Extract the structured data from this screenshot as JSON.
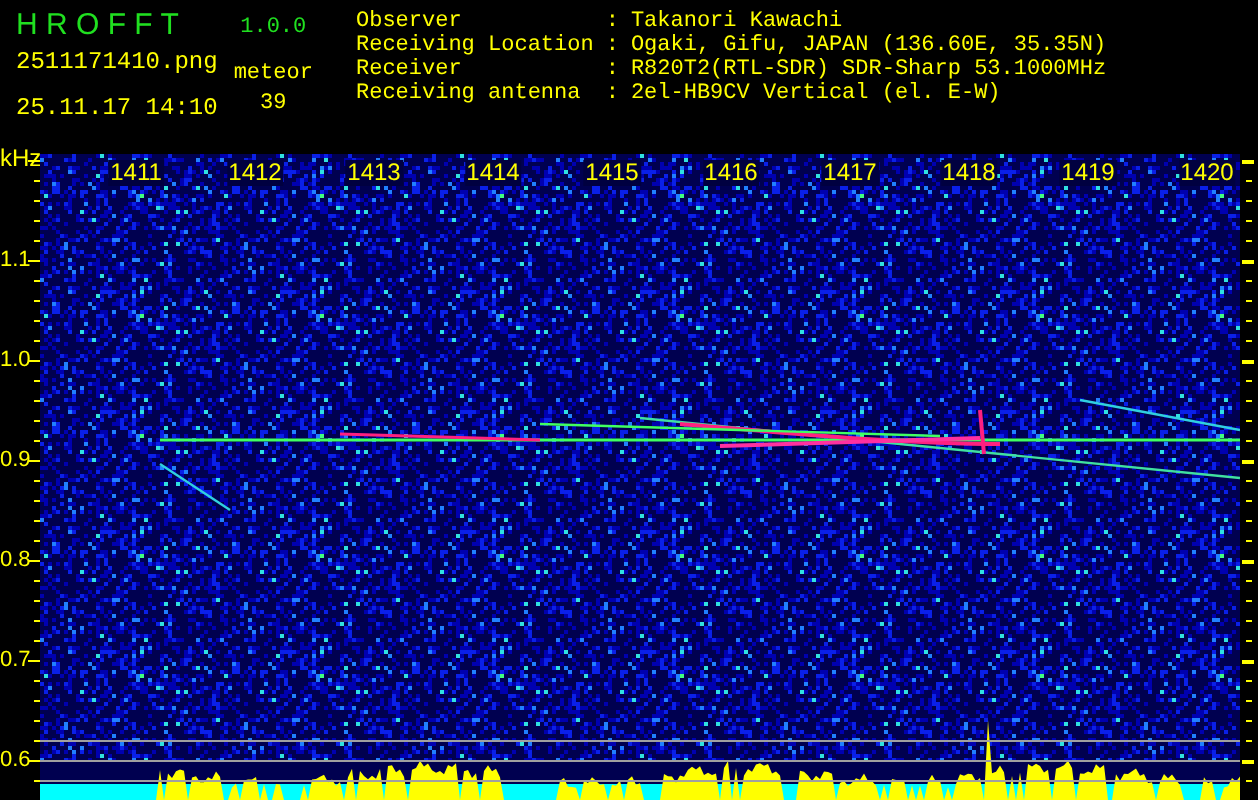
{
  "header": {
    "app_title": "H R O F F T",
    "version": "1.0.0",
    "file_name": "2511171410.png",
    "date_time": "25.11.17 14:10",
    "meteor_label": "meteor",
    "meteor_count": "39",
    "info": [
      {
        "label": "Observer",
        "separator": ":",
        "value": "Takanori Kawachi"
      },
      {
        "label": "Receiving Location",
        "separator": ":",
        "value": "Ogaki, Gifu, JAPAN (136.60E, 35.35N)"
      },
      {
        "label": "Receiver",
        "separator": ":",
        "value": "R820T2(RTL-SDR) SDR-Sharp 53.1000MHz"
      },
      {
        "label": "Receiving antenna",
        "separator": ":",
        "value": "2el-HB9CV Vertical (el. E-W)"
      }
    ]
  },
  "spectrogram": {
    "frequency_unit": "kHz",
    "time_labels": [
      "1411",
      "1412",
      "1413",
      "1414",
      "1415",
      "1416",
      "1417",
      "1418",
      "1419",
      "1420"
    ],
    "frequency_labels": [
      "1.1",
      "1.0",
      "0.9",
      "0.8",
      "0.7",
      "0.6"
    ]
  }
}
